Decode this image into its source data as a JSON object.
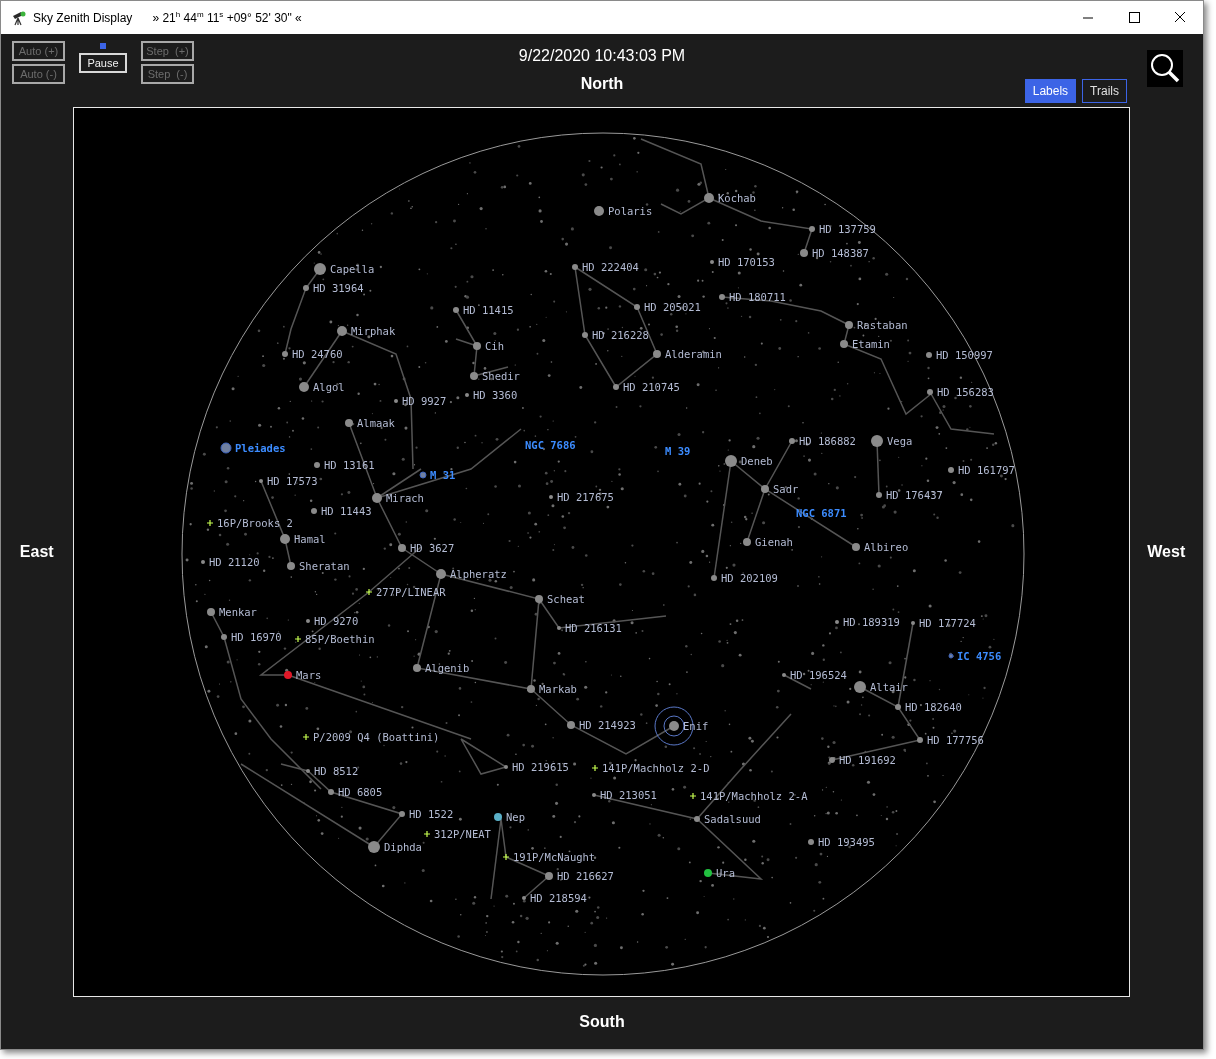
{
  "window": {
    "title": "Sky Zenith Display",
    "coordinates": "» 21$^{h}$ 44$^{m}$ 11$^{s}$   +09° 52' 30\" «"
  },
  "controls": [
    {
      "label": "Auto (+)",
      "disabled": true
    },
    {
      "label": "Auto (-)",
      "disabled": true
    },
    {
      "label": "Pause",
      "disabled": false
    },
    {
      "label": "Step  (+)",
      "disabled": true
    },
    {
      "label": "Step  (-)",
      "disabled": true
    }
  ],
  "run_indicator": {
    "on": true
  },
  "datetime": "9/22/2020 10:43:03 PM",
  "view_toggles": [
    {
      "label": "Labels",
      "selected": true
    },
    {
      "label": "Trails",
      "selected": false
    }
  ],
  "directions": {
    "north": "North",
    "east": "East",
    "west": "West",
    "south": "South"
  },
  "objects": [
    {
      "name": "Kochab",
      "kind": "star",
      "selected": false
    },
    {
      "name": "Polaris",
      "kind": "star",
      "selected": false
    },
    {
      "name": "HD 137759",
      "kind": "star",
      "selected": false
    },
    {
      "name": "HD 170153",
      "kind": "star",
      "selected": false
    },
    {
      "name": "HD 148387",
      "kind": "star",
      "selected": false
    },
    {
      "name": "Capella",
      "kind": "star",
      "selected": false
    },
    {
      "name": "HD 222404",
      "kind": "star",
      "selected": false
    },
    {
      "name": "HD 31964",
      "kind": "star",
      "selected": false
    },
    {
      "name": "HD 180711",
      "kind": "star",
      "selected": false
    },
    {
      "name": "HD 11415",
      "kind": "star",
      "selected": false
    },
    {
      "name": "HD 205021",
      "kind": "star",
      "selected": false
    },
    {
      "name": "Mirphak",
      "kind": "star",
      "selected": false
    },
    {
      "name": "HD 216228",
      "kind": "star",
      "selected": false
    },
    {
      "name": "Rastaban",
      "kind": "star",
      "selected": false
    },
    {
      "name": "Cih",
      "kind": "star",
      "selected": false
    },
    {
      "name": "Etamin",
      "kind": "star",
      "selected": false
    },
    {
      "name": "HD 24760",
      "kind": "star",
      "selected": false
    },
    {
      "name": "Alderamin",
      "kind": "star",
      "selected": false
    },
    {
      "name": "HD 150997",
      "kind": "star",
      "selected": false
    },
    {
      "name": "Shedir",
      "kind": "star",
      "selected": false
    },
    {
      "name": "Algol",
      "kind": "star",
      "selected": false
    },
    {
      "name": "HD 3360",
      "kind": "star",
      "selected": false
    },
    {
      "name": "HD 210745",
      "kind": "star",
      "selected": false
    },
    {
      "name": "HD 156283",
      "kind": "star",
      "selected": false
    },
    {
      "name": "HD 9927",
      "kind": "star",
      "selected": false
    },
    {
      "name": "Almaak",
      "kind": "star",
      "selected": false
    },
    {
      "name": "Pleiades",
      "kind": "dso",
      "selected": false
    },
    {
      "name": "NGC 7686",
      "kind": "dso",
      "selected": false
    },
    {
      "name": "M 39",
      "kind": "dso",
      "selected": false
    },
    {
      "name": "HD 186882",
      "kind": "star",
      "selected": false
    },
    {
      "name": "Vega",
      "kind": "star",
      "selected": false
    },
    {
      "name": "HD 13161",
      "kind": "star",
      "selected": false
    },
    {
      "name": "M 31",
      "kind": "dso",
      "selected": false
    },
    {
      "name": "Deneb",
      "kind": "star",
      "selected": false
    },
    {
      "name": "HD 161797",
      "kind": "star",
      "selected": false
    },
    {
      "name": "HD 17573",
      "kind": "star",
      "selected": false
    },
    {
      "name": "Mirach",
      "kind": "star",
      "selected": false
    },
    {
      "name": "HD 217675",
      "kind": "star",
      "selected": false
    },
    {
      "name": "Sadr",
      "kind": "star",
      "selected": false
    },
    {
      "name": "HD 176437",
      "kind": "star",
      "selected": false
    },
    {
      "name": "HD 11443",
      "kind": "star",
      "selected": false
    },
    {
      "name": "NGC 6871",
      "kind": "dso",
      "selected": false
    },
    {
      "name": "16P/Brooks 2",
      "kind": "comet",
      "selected": false
    },
    {
      "name": "Hamal",
      "kind": "star",
      "selected": false
    },
    {
      "name": "HD 3627",
      "kind": "star",
      "selected": false
    },
    {
      "name": "Gienah",
      "kind": "star",
      "selected": false
    },
    {
      "name": "Albireo",
      "kind": "star",
      "selected": false
    },
    {
      "name": "HD 21120",
      "kind": "star",
      "selected": false
    },
    {
      "name": "Sheratan",
      "kind": "star",
      "selected": false
    },
    {
      "name": "Alpheratz",
      "kind": "star",
      "selected": false
    },
    {
      "name": "HD 202109",
      "kind": "star",
      "selected": false
    },
    {
      "name": "277P/LINEAR",
      "kind": "comet",
      "selected": false
    },
    {
      "name": "Scheat",
      "kind": "star",
      "selected": false
    },
    {
      "name": "Menkar",
      "kind": "star",
      "selected": false
    },
    {
      "name": "HD 9270",
      "kind": "star",
      "selected": false
    },
    {
      "name": "HD 216131",
      "kind": "star",
      "selected": false
    },
    {
      "name": "HD 189319",
      "kind": "star",
      "selected": false
    },
    {
      "name": "HD 177724",
      "kind": "star",
      "selected": false
    },
    {
      "name": "HD 16970",
      "kind": "star",
      "selected": false
    },
    {
      "name": "85P/Boethin",
      "kind": "comet",
      "selected": false
    },
    {
      "name": "IC 4756",
      "kind": "dso",
      "selected": false
    },
    {
      "name": "Algenib",
      "kind": "star",
      "selected": false
    },
    {
      "name": "Mars",
      "kind": "planet",
      "color": "#e01828",
      "selected": false
    },
    {
      "name": "HD 196524",
      "kind": "star",
      "selected": false
    },
    {
      "name": "Markab",
      "kind": "star",
      "selected": false
    },
    {
      "name": "Altair",
      "kind": "star",
      "selected": false
    },
    {
      "name": "HD 182640",
      "kind": "star",
      "selected": false
    },
    {
      "name": "HD 214923",
      "kind": "star",
      "selected": false
    },
    {
      "name": "Enif",
      "kind": "star",
      "selected": true
    },
    {
      "name": "P/2009 Q4 (Boattini)",
      "kind": "comet",
      "selected": false
    },
    {
      "name": "HD 177756",
      "kind": "star",
      "selected": false
    },
    {
      "name": "HD 8512",
      "kind": "star",
      "selected": false
    },
    {
      "name": "HD 219615",
      "kind": "star",
      "selected": false
    },
    {
      "name": "141P/Machholz 2-D",
      "kind": "comet",
      "selected": false
    },
    {
      "name": "HD 191692",
      "kind": "star",
      "selected": false
    },
    {
      "name": "HD 6805",
      "kind": "star",
      "selected": false
    },
    {
      "name": "HD 213051",
      "kind": "star",
      "selected": false
    },
    {
      "name": "141P/Machholz 2-A",
      "kind": "comet",
      "selected": false
    },
    {
      "name": "HD 1522",
      "kind": "star",
      "selected": false
    },
    {
      "name": "Nep",
      "kind": "planet",
      "color": "#5ab0c8",
      "selected": false
    },
    {
      "name": "Sadalsuud",
      "kind": "star",
      "selected": false
    },
    {
      "name": "312P/NEAT",
      "kind": "comet",
      "selected": false
    },
    {
      "name": "Diphda",
      "kind": "star",
      "selected": false
    },
    {
      "name": "HD 193495",
      "kind": "star",
      "selected": false
    },
    {
      "name": "191P/McNaught",
      "kind": "comet",
      "selected": false
    },
    {
      "name": "HD 216627",
      "kind": "star",
      "selected": false
    },
    {
      "name": "Ura",
      "kind": "planet",
      "color": "#22c040",
      "selected": false
    },
    {
      "name": "HD 218594",
      "kind": "star",
      "selected": false
    }
  ]
}
